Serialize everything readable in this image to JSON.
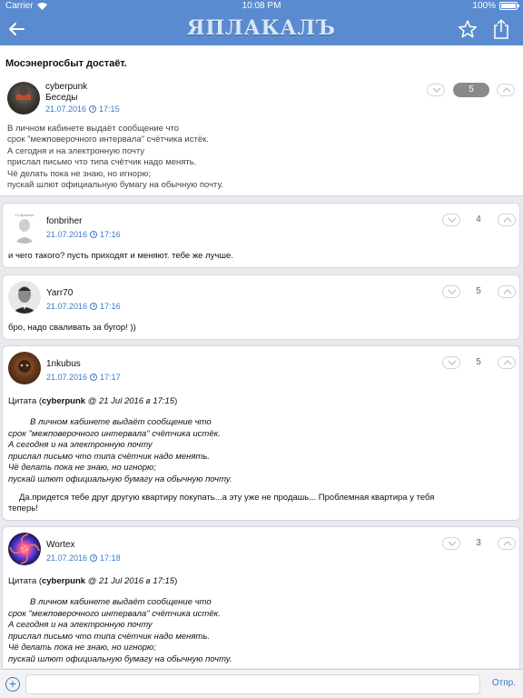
{
  "status": {
    "carrier": "Carrier",
    "time": "10:08 PM",
    "battery": "100%"
  },
  "nav": {
    "logo": "ЯПЛАКАЛЪ"
  },
  "topic": {
    "title": "Мосэнергосбыт достаёт."
  },
  "posts": [
    {
      "user": "cyberpunk",
      "section": "Беседы",
      "date": "21.07.2016",
      "time": "17:15",
      "score": "5",
      "text": "В личном кабинете выдаёт сообщение что\nсрок \"межповерочного интервала\" счётчика истёк.\nА сегодня и на электронную почту\nприслал письмо что типа счётчик надо менять.\nЧё делать пока не знаю, но игнорю;\nпускай шлют официальную бумагу на обычную почту."
    },
    {
      "user": "fonbriher",
      "date": "21.07.2016",
      "time": "17:16",
      "score": "4",
      "avatar_caption": "«Ъ Артисты»",
      "text": "и чего такого? пусть приходят и меняют. тебе же лучше."
    },
    {
      "user": "Yarr70",
      "date": "21.07.2016",
      "time": "17:16",
      "score": "5",
      "text": "бро, надо сваливать за бугор! ))"
    },
    {
      "user": "1nkubus",
      "date": "21.07.2016",
      "time": "17:17",
      "score": "5",
      "quote_prefix": "Цитата (",
      "quote_author": "cyberpunk",
      "quote_meta": " @ 21 Jul 2016 в 17:15",
      "quote_suffix": ")",
      "quote_text": "В личном кабинете выдаёт сообщение что\nсрок \"межповерочного интервала\" счётчика истёк.\nА сегодня и на электронную почту\nприслал письмо что типа счётчик надо менять.\nЧё делать пока не знаю, но игнорю;\nпускай шлют официальную бумагу на обычную почту.",
      "reply_line1": "Да.придется тебе друг другую квартиру покупать...а эту уже не продашь... Проблемная квартира у тебя",
      "reply_line2": "теперь!"
    },
    {
      "user": "Wortex",
      "date": "21.07.2016",
      "time": "17:18",
      "score": "3",
      "quote_prefix": "Цитата (",
      "quote_author": "cyberpunk",
      "quote_meta": " @ 21 Jul 2016 в 17:15",
      "quote_suffix": ")",
      "quote_text": "В личном кабинете выдаёт сообщение что\nсрок \"межповерочного интервала\" счётчика истёк.\nА сегодня и на электронную почту\nприслал письмо что типа счётчик надо менять.\nЧё делать пока не знаю, но игнорю;\nпускай шлют официальную бумагу на обычную почту."
    }
  ],
  "composer": {
    "placeholder": "",
    "send_label": "Отпр."
  },
  "colors": {
    "bar": "#5a8bd0",
    "link": "#3b78c8"
  }
}
